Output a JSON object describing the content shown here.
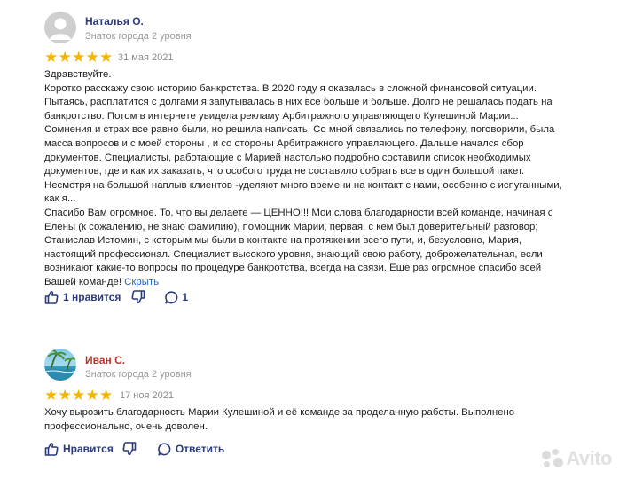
{
  "reviews": [
    {
      "author": "Наталья О.",
      "level": "Знаток города 2 уровня",
      "rating": 5,
      "date": "31 мая 2021",
      "text": "Здравствуйте.\nКоротко расскажу свою историю банкротства. В 2020 году я оказалась в сложной финансовой ситуации.\nПытаясь, расплатится с долгами я запутывалась в них все больше и больше. Долго не решалась подать на\nбанкротство. Потом в интернете увидела рекламу Арбитражного управляющего Кулешиной Марии...\nСомнения и страх все равно были, но решила написать. Со мной связались по телефону, поговорили, была\nмасса вопросов и с моей стороны , и со стороны Арбитражного управляющего. Дальше начался сбор\nдокументов. Специалисты, работающие с Марией настолько подробно составили список необходимых\nдокументов, где и как их заказать, что особого труда не составило собрать все в один большой пакет.\nНесмотря на большой наплыв клиентов -уделяют много времени на контакт с нами, особенно с испуганными,\nкак я...\nСпасибо Вам огромное. То, что вы делаете — ЦЕННО!!! Мои слова благодарности всей команде, начиная с\nЕлены (к сожалению, не знаю фамилию), помощник Марии, первая, с кем был доверительный разговор;\nСтанислав Истомин, с которым мы были в контакте на протяжении всего пути, и, безусловно, Мария,\nнастоящий профессионал. Специалист высокого уровня, знающий свою работу, доброжелательная, если\nвозникают какие-то вопросы по процедуре банкротства, всегда на связи. Еще раз огромное спасибо всей\nВашей команде!",
      "collapse_label": "Скрыть",
      "like_label": "1 нравится",
      "comments_label": "1"
    },
    {
      "author": "Иван С.",
      "level": "Знаток города 2 уровня",
      "rating": 5,
      "date": "17 ноя 2021",
      "text": "Хочу вырозить благодарность Марии Кулешиной и её команде за проделанную работы. Выполнено\nпрофессионально, очень доволен.",
      "like_label": "Нравится",
      "reply_label": "Ответить"
    }
  ],
  "watermark": "Avito",
  "colors": {
    "star": "#f5b400",
    "author_1": "#2a3a7c",
    "author_2": "#b8362c",
    "link": "#2a63c2"
  },
  "icons": [
    "user-avatar-placeholder",
    "beach-avatar",
    "thumbs-up-icon",
    "thumbs-down-icon",
    "comment-icon",
    "avito-logo"
  ]
}
